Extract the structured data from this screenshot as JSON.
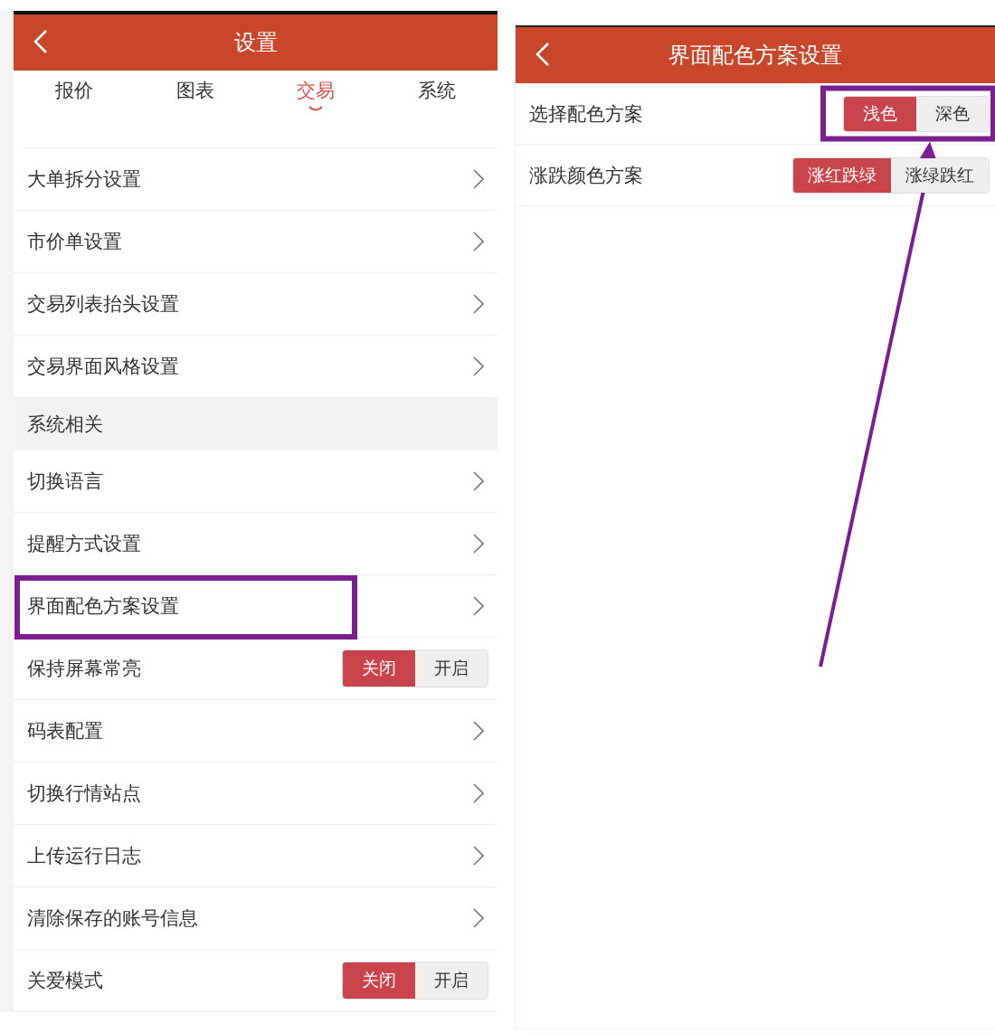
{
  "left_screen": {
    "title": "设置",
    "tabs": [
      {
        "label": "报价",
        "selected": false
      },
      {
        "label": "图表",
        "selected": false
      },
      {
        "label": "交易",
        "selected": true
      },
      {
        "label": "系统",
        "selected": false
      }
    ],
    "rows": [
      {
        "kind": "link",
        "label": "大单拆分设置",
        "highlighted": false
      },
      {
        "kind": "link",
        "label": "市价单设置",
        "highlighted": false
      },
      {
        "kind": "link",
        "label": "交易列表抬头设置",
        "highlighted": false
      },
      {
        "kind": "link",
        "label": "交易界面风格设置",
        "highlighted": false
      },
      {
        "kind": "section",
        "label": "系统相关"
      },
      {
        "kind": "link",
        "label": "切换语言",
        "highlighted": false
      },
      {
        "kind": "link",
        "label": "提醒方式设置",
        "highlighted": false
      },
      {
        "kind": "link",
        "label": "界面配色方案设置",
        "highlighted": true
      },
      {
        "kind": "toggle",
        "label": "保持屏幕常亮",
        "highlighted": false,
        "options": [
          {
            "label": "关闭",
            "selected": true
          },
          {
            "label": "开启",
            "selected": false
          }
        ]
      },
      {
        "kind": "link",
        "label": "码表配置",
        "highlighted": false
      },
      {
        "kind": "link",
        "label": "切换行情站点",
        "highlighted": false
      },
      {
        "kind": "link",
        "label": "上传运行日志",
        "highlighted": false
      },
      {
        "kind": "link",
        "label": "清除保存的账号信息",
        "highlighted": false
      },
      {
        "kind": "toggle",
        "label": "关爱模式",
        "highlighted": false,
        "options": [
          {
            "label": "关闭",
            "selected": true
          },
          {
            "label": "开启",
            "selected": false
          }
        ]
      }
    ]
  },
  "right_screen": {
    "title": "界面配色方案设置",
    "rows": [
      {
        "kind": "toggle",
        "label": "选择配色方案",
        "highlighted": true,
        "options": [
          {
            "label": "浅色",
            "selected": true
          },
          {
            "label": "深色",
            "selected": false
          }
        ]
      },
      {
        "kind": "toggle",
        "label": "涨跌颜色方案",
        "highlighted": false,
        "options": [
          {
            "label": "涨红跌绿",
            "selected": true
          },
          {
            "label": "涨绿跌红",
            "selected": false
          }
        ]
      }
    ]
  },
  "annotation_arrow": true
}
